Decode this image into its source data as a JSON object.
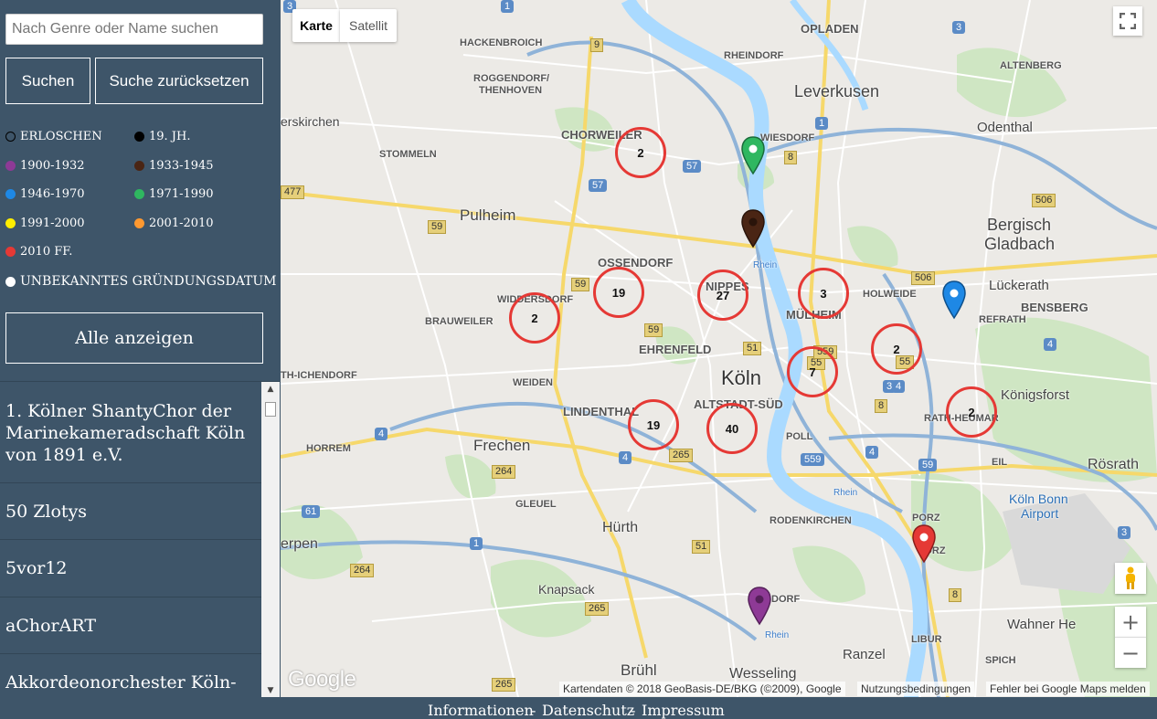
{
  "search": {
    "placeholder": "Nach Genre oder Name suchen"
  },
  "buttons": {
    "search": "Suchen",
    "reset": "Suche zurücksetzen",
    "show_all": "Alle anzeigen"
  },
  "legend": [
    {
      "label": "ERLOSCHEN",
      "color": "#3e5569",
      "ring": true
    },
    {
      "label": "19. JH.",
      "color": "#000000"
    },
    {
      "label": "1900-1932",
      "color": "#8e3a96"
    },
    {
      "label": "1933-1945",
      "color": "#4a2514"
    },
    {
      "label": "1946-1970",
      "color": "#1e88e5"
    },
    {
      "label": "1971-1990",
      "color": "#2fb760"
    },
    {
      "label": "1991-2000",
      "color": "#ffee00"
    },
    {
      "label": "2001-2010",
      "color": "#ff9930"
    },
    {
      "label": "2010 FF.",
      "color": "#e53935"
    },
    {
      "label": "UNBEKANNTES GRÜNDUNGSDATUM",
      "color": "#ffffff"
    }
  ],
  "choir_list": [
    "1. Kölner ShantyChor der Marinekameradschaft Köln von 1891 e.V.",
    "50 Zlotys",
    "5vor12",
    "aChorART",
    "Akkordeonorchester Köln-Deutz"
  ],
  "map": {
    "tabs": {
      "karte": "Karte",
      "satellit": "Satellit"
    },
    "clusters": [
      "2",
      "19",
      "2",
      "27",
      "3",
      "2",
      "7",
      "19",
      "40",
      "2"
    ],
    "places": {
      "opladen": "OPLADEN",
      "hackenbroich": "HACKENBROICH",
      "rheindorf": "RHEINDORF",
      "roggendorf": "ROGGENDORF/",
      "thenhoven": "THENHOVEN",
      "leverkusen": "Leverkusen",
      "altenberg": "ALTENBERG",
      "odenthal": "Odenthal",
      "kirchen": "erskirchen",
      "chorweiler": "CHORWEILER",
      "stommeln": "STOMMELN",
      "wiesdorf": "WIESDORF",
      "pulheim": "Pulheim",
      "bergisch1": "Bergisch",
      "bergisch2": "Gladbach",
      "ossendorf": "OSSENDORF",
      "widdersdorf": "WIDDERSDORF",
      "brauweiler": "BRAUWEILER",
      "nippes": "NIPPES",
      "holweide": "HOLWEIDE",
      "luckerath": "Lückerath",
      "bensberg": "BENSBERG",
      "refrath": "REFRATH",
      "muelheim": "MÜLHEIM",
      "ehrenfeld": "EHRENFELD",
      "koeln": "Köln",
      "ichendorf": "TH-ICHENDORF",
      "weiden": "WEIDEN",
      "altstadt": "ALTSTADT-SÜD",
      "lindenthal": "LINDENTHAL",
      "koenigsforst": "Königsforst",
      "rathheumar": "RATH-HEUMAR",
      "horrem": "HORREM",
      "frechen": "Frechen",
      "poll": "POLL",
      "eil": "EIL",
      "roesrath": "Rösrath",
      "gleuel": "GLEUEL",
      "koelnbonn1": "Köln Bonn",
      "koelnbonn2": "Airport",
      "huerth": "Hürth",
      "rodenkirchen": "RODENKIRCHEN",
      "porz1": "PORZ",
      "porz2": "PORZ",
      "kerpen": "erpen",
      "knapsack": "Knapsack",
      "dorf": "DORF",
      "wahner": "Wahner He",
      "libur": "LIBUR",
      "ranzel": "Ranzel",
      "spich": "SPICH",
      "bruehl": "Brühl",
      "wesseling": "Wesseling",
      "rhein1": "Rhein",
      "rhein2": "Rhein",
      "rhein3": "Rhein"
    },
    "shields_yellow": [
      "9",
      "8",
      "477",
      "59",
      "506",
      "59",
      "506",
      "59",
      "51",
      "55",
      "55",
      "8",
      "264",
      "265",
      "51",
      "264",
      "265",
      "265",
      "8",
      "559"
    ],
    "shields_blue": [
      "1",
      "3",
      "1",
      "57",
      "57",
      "3",
      "4",
      "4",
      "4",
      "559",
      "4",
      "59",
      "61",
      "1",
      "3",
      "4",
      "3"
    ],
    "google": "Google",
    "attribution": "Kartendaten © 2018 GeoBasis-DE/BKG (©2009), Google",
    "terms": "Nutzungsbedingungen",
    "report": "Fehler bei Google Maps melden"
  },
  "footer": {
    "info": "Informationen",
    "privacy": "Datenschutz",
    "imprint": "Impressum",
    "sep": "-"
  }
}
